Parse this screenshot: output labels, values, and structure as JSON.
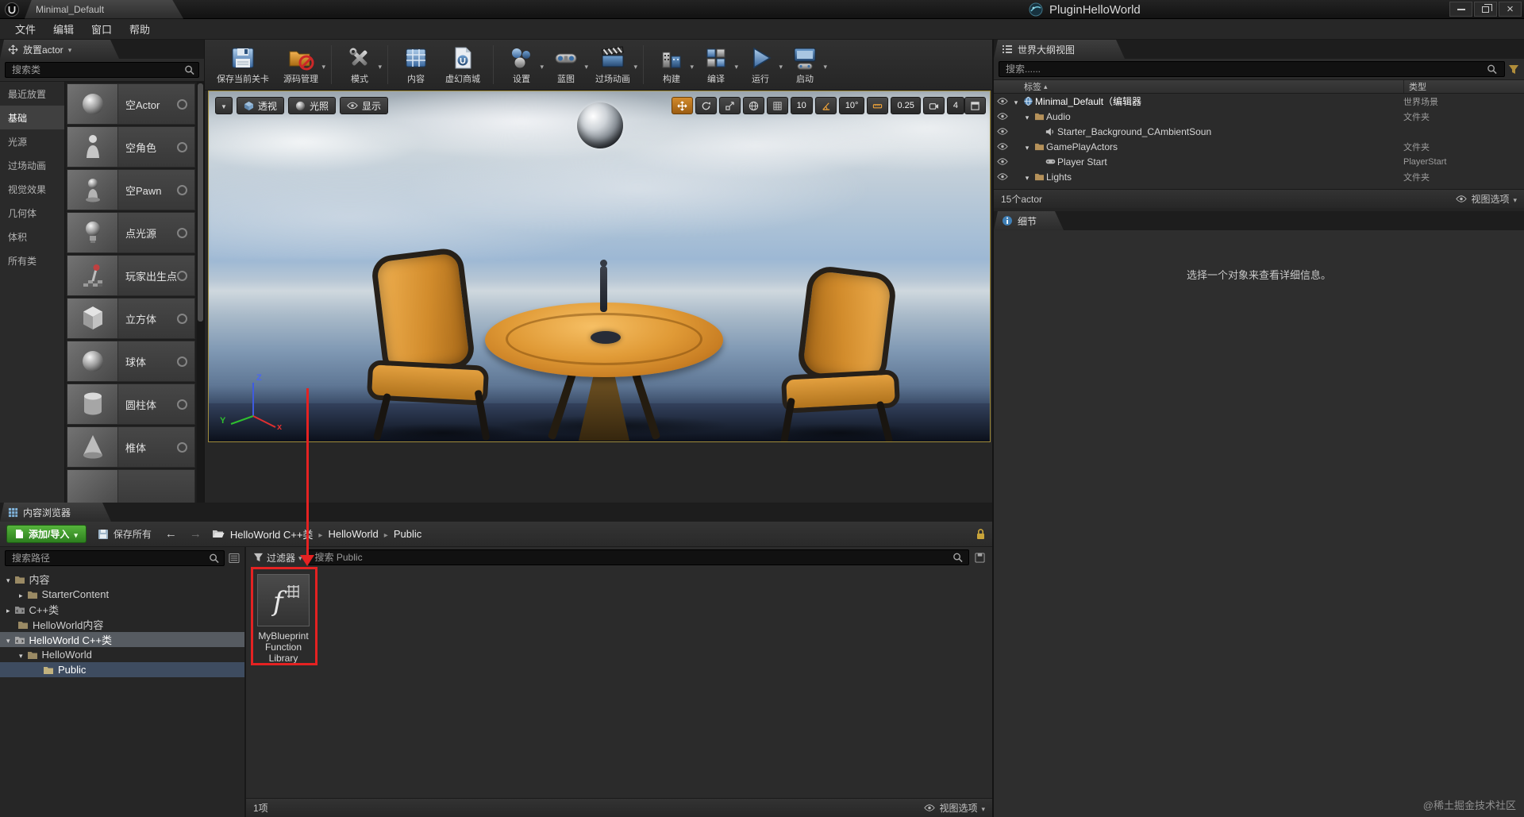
{
  "titlebar": {
    "tab_title": "Minimal_Default",
    "plugin_title": "PluginHelloWorld"
  },
  "menubar": {
    "items": [
      "文件",
      "编辑",
      "窗口",
      "帮助"
    ]
  },
  "place_actors": {
    "title": "放置actor",
    "search_placeholder": "搜索类",
    "categories": [
      "最近放置",
      "基础",
      "光源",
      "过场动画",
      "视觉效果",
      "几何体",
      "体积",
      "所有类"
    ],
    "selected_category": "基础",
    "items": [
      "空Actor",
      "空角色",
      "空Pawn",
      "点光源",
      "玩家出生点",
      "立方体",
      "球体",
      "圆柱体",
      "椎体"
    ]
  },
  "toolbar": {
    "save": "保存当前关卡",
    "source_control": "源码管理",
    "modes": "模式",
    "content": "内容",
    "marketplace": "虚幻商城",
    "settings": "设置",
    "blueprints": "蓝图",
    "cinematics": "过场动画",
    "build": "构建",
    "compile": "编译",
    "play": "运行",
    "launch": "启动"
  },
  "viewport": {
    "view_mode": "透视",
    "lit_mode": "光照",
    "show_menu": "显示",
    "grid_snap": "10",
    "angle_snap": "10°",
    "scale_snap": "0.25",
    "camera_speed": "4",
    "axis_x": "x",
    "axis_y": "Y",
    "axis_z": "Z"
  },
  "world_outliner": {
    "title": "世界大纲视图",
    "search_placeholder": "搜索......",
    "col_label": "标签",
    "col_type": "类型",
    "rows": [
      {
        "label": "Minimal_Default（编辑器",
        "type": "世界场景"
      },
      {
        "label": "Audio",
        "type": "文件夹"
      },
      {
        "label": "Starter_Background_CAmbientSoun",
        "type": ""
      },
      {
        "label": "GamePlayActors",
        "type": "文件夹"
      },
      {
        "label": "Player Start",
        "type": "PlayerStart"
      },
      {
        "label": "Lights",
        "type": "文件夹"
      }
    ],
    "footer_count": "15个actor",
    "view_options": "视图选项"
  },
  "details": {
    "title": "细节",
    "empty_message": "选择一个对象来查看详细信息。"
  },
  "content_browser": {
    "tab": "内容浏览器",
    "add_import": "添加/导入",
    "save_all": "保存所有",
    "breadcrumb": [
      "HelloWorld C++类",
      "HelloWorld",
      "Public"
    ],
    "path_search_placeholder": "搜索路径",
    "tree": [
      "内容",
      "StarterContent",
      "C++类",
      "HelloWorld内容",
      "HelloWorld C++类",
      "HelloWorld",
      "Public"
    ],
    "filter_label": "过滤器",
    "asset_search_placeholder": "搜索 Public",
    "asset_name_lines": [
      "MyBlueprint",
      "Function",
      "Library"
    ],
    "footer_count": "1项",
    "view_options": "视图选项"
  },
  "watermark": "@稀土掘金技术社区"
}
